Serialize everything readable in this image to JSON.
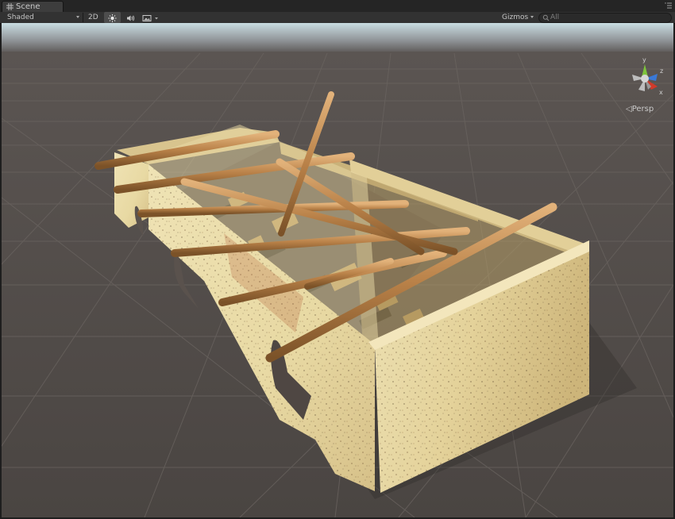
{
  "tab": {
    "label": "Scene",
    "icon": "scene-grid-icon",
    "menu_icon": "panel-menu-icon"
  },
  "toolbar": {
    "shading_mode": "Shaded",
    "mode_2d": "2D",
    "lighting_icon": "sun-icon",
    "audio_icon": "speaker-icon",
    "effects_icon": "image-icon",
    "gizmos_label": "Gizmos",
    "search_placeholder": "All",
    "search_icon": "search-icon"
  },
  "viewport": {
    "projection_label": "Persp",
    "axes": {
      "y": "y",
      "x": "x",
      "z": "z"
    },
    "axis_colors": {
      "x": "#d03a2a",
      "y": "#7dc43b",
      "z": "#3a78d6"
    }
  }
}
